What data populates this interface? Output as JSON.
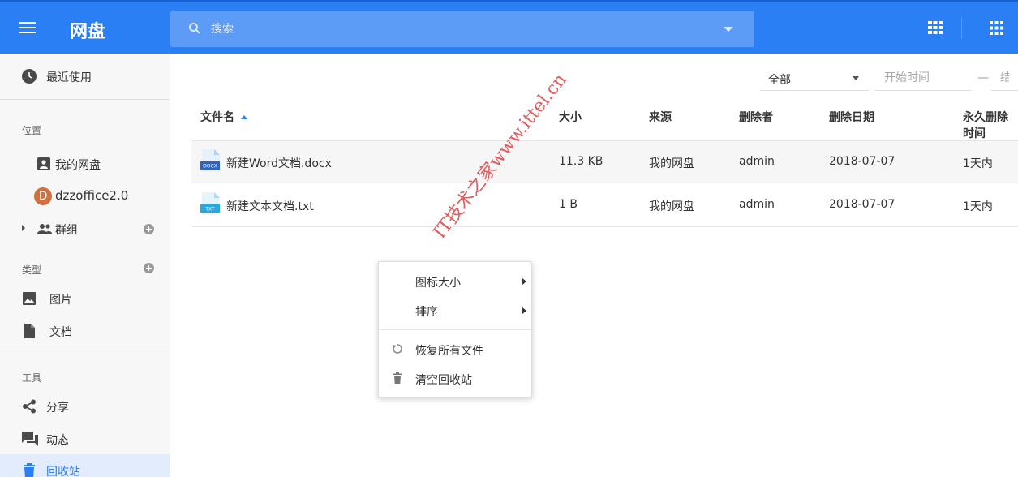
{
  "app": {
    "title": "网盘"
  },
  "search": {
    "placeholder": "搜索"
  },
  "sidebar": {
    "recent": "最近使用",
    "location_header": "位置",
    "my_drive": "我的网盘",
    "org_initial": "D",
    "org": "dzzoffice2.0",
    "groups": "群组",
    "type_header": "类型",
    "images": "图片",
    "docs": "文档",
    "tools_header": "工具",
    "share": "分享",
    "activity": "动态",
    "recycle": "回收站"
  },
  "filters": {
    "type_selected": "全部",
    "start_placeholder": "开始时间",
    "dash": "—",
    "end_placeholder": "结束时间"
  },
  "table": {
    "columns": [
      "文件名",
      "大小",
      "来源",
      "删除者",
      "删除日期",
      "永久删除时间"
    ],
    "rows": [
      {
        "name": "新建Word文档.docx",
        "icon": "docx-file-icon",
        "icon_label": "DOCX",
        "size": "11.3 KB",
        "source": "我的网盘",
        "deleted_by": "admin",
        "date": "2018-07-07",
        "expires": "1天内"
      },
      {
        "name": "新建文本文档.txt",
        "icon": "txt-file-icon",
        "icon_label": "TXT",
        "size": "1 B",
        "source": "我的网盘",
        "deleted_by": "admin",
        "date": "2018-07-07",
        "expires": "1天内"
      }
    ]
  },
  "context_menu": {
    "icon_size": "图标大小",
    "sort": "排序",
    "restore_all": "恢复所有文件",
    "empty_recycle": "清空回收站"
  },
  "watermark": "IT技术之家www.ittel.cn",
  "colors": {
    "primary": "#2b7ff5",
    "search_bg": "#5c9cf7",
    "watermark": "#e04a4a"
  }
}
